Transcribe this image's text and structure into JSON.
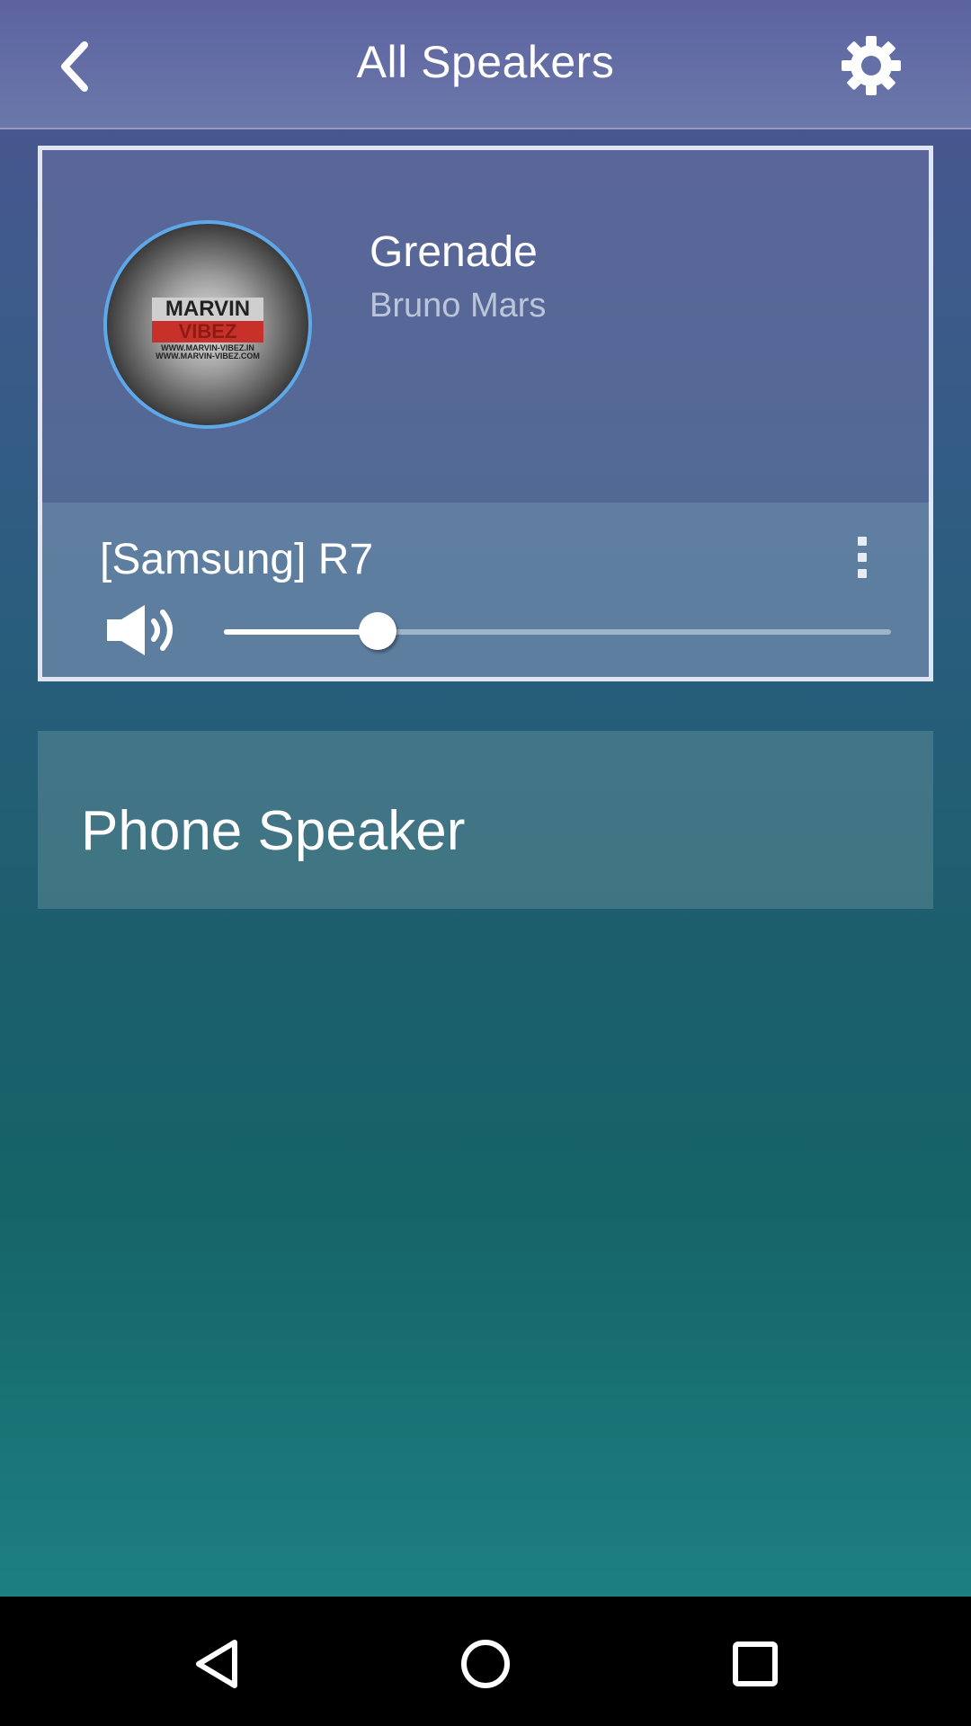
{
  "header": {
    "title": "All Speakers",
    "back_icon": "chevron-left-icon",
    "settings_icon": "gear-icon"
  },
  "now_playing": {
    "album_art_text": "MARVIN",
    "album_art_subtext": "VIBEZ",
    "album_art_url_text": "WWW.MARVIN-VIBEZ.IN WWW.MARVIN-VIBEZ.COM",
    "title": "Grenade",
    "artist": "Bruno Mars"
  },
  "device": {
    "name": "[Samsung] R7",
    "more_icon": "more-vertical-icon",
    "volume_icon": "speaker-volume-icon",
    "volume_fraction": 0.23
  },
  "other_speakers": [
    {
      "label": "Phone Speaker"
    }
  ],
  "nav_bar": {
    "back_icon": "nav-back-icon",
    "home_icon": "nav-home-icon",
    "recents_icon": "nav-recents-icon"
  },
  "colors": {
    "accent_ring": "#5fa8e8",
    "nav_background": "#000000"
  }
}
